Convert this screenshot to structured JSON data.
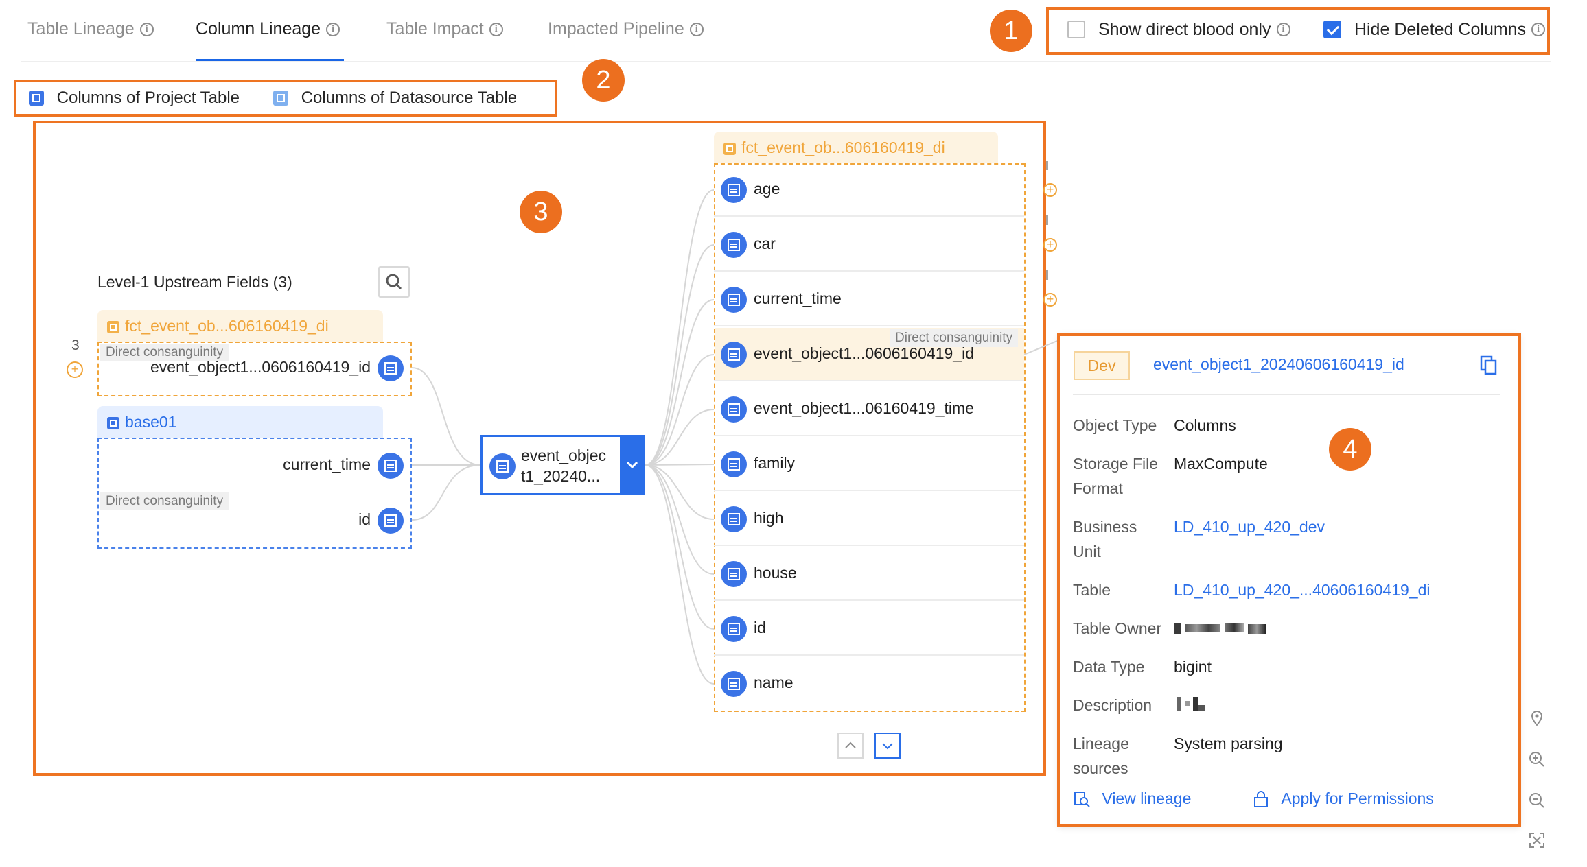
{
  "tabs": [
    {
      "label": "Table Lineage"
    },
    {
      "label": "Column Lineage"
    },
    {
      "label": "Table Impact"
    },
    {
      "label": "Impacted Pipeline"
    }
  ],
  "options": {
    "show_direct_blood_only": {
      "label": "Show direct blood only",
      "checked": false
    },
    "hide_deleted_columns": {
      "label": "Hide Deleted Columns",
      "checked": true
    }
  },
  "legend": {
    "project_table": "Columns of Project Table",
    "datasource_table": "Columns of Datasource Table"
  },
  "callouts": [
    "1",
    "2",
    "3",
    "4"
  ],
  "upstream": {
    "title": "Level-1 Upstream Fields (3)",
    "count": "3",
    "group1": {
      "table": "fct_event_ob...606160419_di",
      "tag": "Direct consanguinity",
      "fields": [
        "event_object1...0606160419_id"
      ]
    },
    "group2": {
      "table": "base01",
      "tag": "Direct consanguinity",
      "fields": [
        "current_time",
        "id"
      ]
    }
  },
  "center_node": {
    "line1": "event_objec",
    "line2": "t1_20240..."
  },
  "downstream": {
    "table": "fct_event_ob...606160419_di",
    "tag": "Direct consanguinity",
    "fields": [
      "age",
      "car",
      "current_time",
      "event_object1...0606160419_id",
      "event_object1...06160419_time",
      "family",
      "high",
      "house",
      "id",
      "name"
    ]
  },
  "detail": {
    "env": "Dev",
    "name": "event_object1_20240606160419_id",
    "object_type_label": "Object Type",
    "object_type": "Columns",
    "storage_label_1": "Storage File",
    "storage_label_2": "Format",
    "storage": "MaxCompute",
    "bu_label_1": "Business",
    "bu_label_2": "Unit",
    "bu": "LD_410_up_420_dev",
    "table_label": "Table",
    "table": "LD_410_up_420_...40606160419_di",
    "owner_label": "Table Owner",
    "data_type_label": "Data Type",
    "data_type": "bigint",
    "description_label": "Description",
    "lineage_label_1": "Lineage",
    "lineage_label_2": "sources",
    "lineage": "System parsing",
    "view_lineage": "View lineage",
    "apply_permissions": "Apply for Permissions"
  },
  "colors": {
    "accent": "#2a6ee8",
    "highlight": "#ee7422",
    "orange_table": "#f0a53a"
  }
}
